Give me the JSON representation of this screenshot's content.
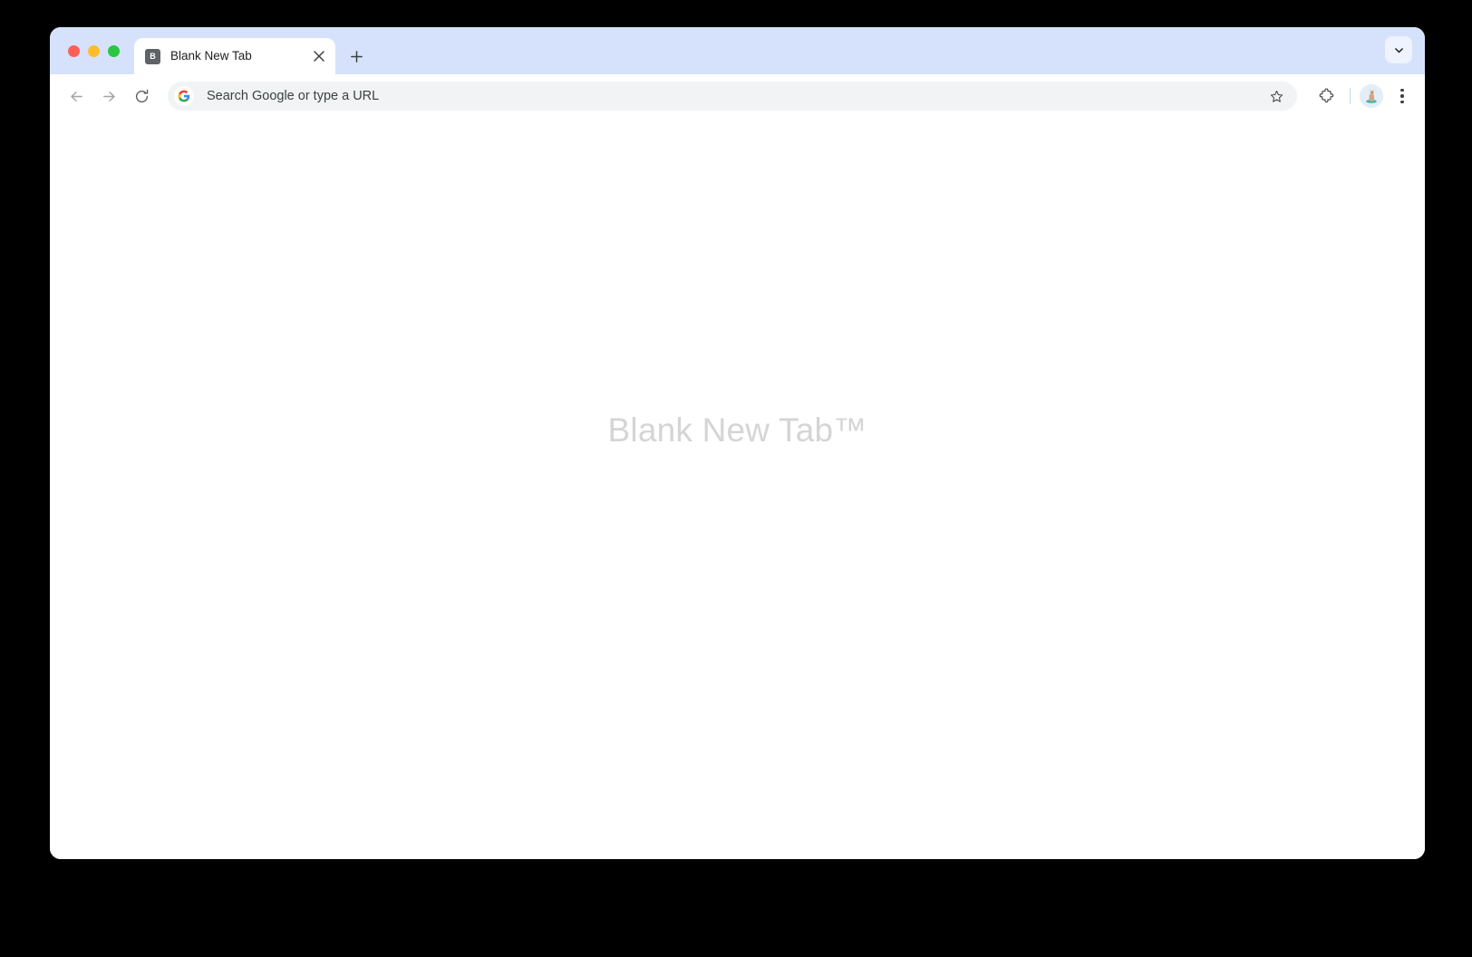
{
  "window": {
    "traffic_lights": [
      {
        "name": "close",
        "color": "#ff5f57"
      },
      {
        "name": "minimize",
        "color": "#febc2e"
      },
      {
        "name": "maximize",
        "color": "#28c840"
      }
    ],
    "tabstrip_bg": "#d6e2fb"
  },
  "tabstrip": {
    "tabs": [
      {
        "favicon_letter": "B",
        "title": "Blank New Tab",
        "close_label": "Close tab",
        "active": true
      }
    ],
    "new_tab_label": "New Tab",
    "tab_search_label": "Search tabs"
  },
  "toolbar": {
    "back_label": "Back",
    "forward_label": "Forward",
    "reload_label": "Reload",
    "omnibox": {
      "value": "",
      "placeholder": "Search Google or type a URL",
      "display_text": "Search Google or type a URL",
      "search_engine": "Google"
    },
    "bookmark_label": "Bookmark this tab",
    "extensions_label": "Extensions",
    "profile_label": "Profile",
    "menu_label": "Customize and control Google Chrome"
  },
  "page": {
    "watermark": "Blank New Tab™",
    "background": "#ffffff",
    "watermark_color": "#d5d5d5"
  }
}
